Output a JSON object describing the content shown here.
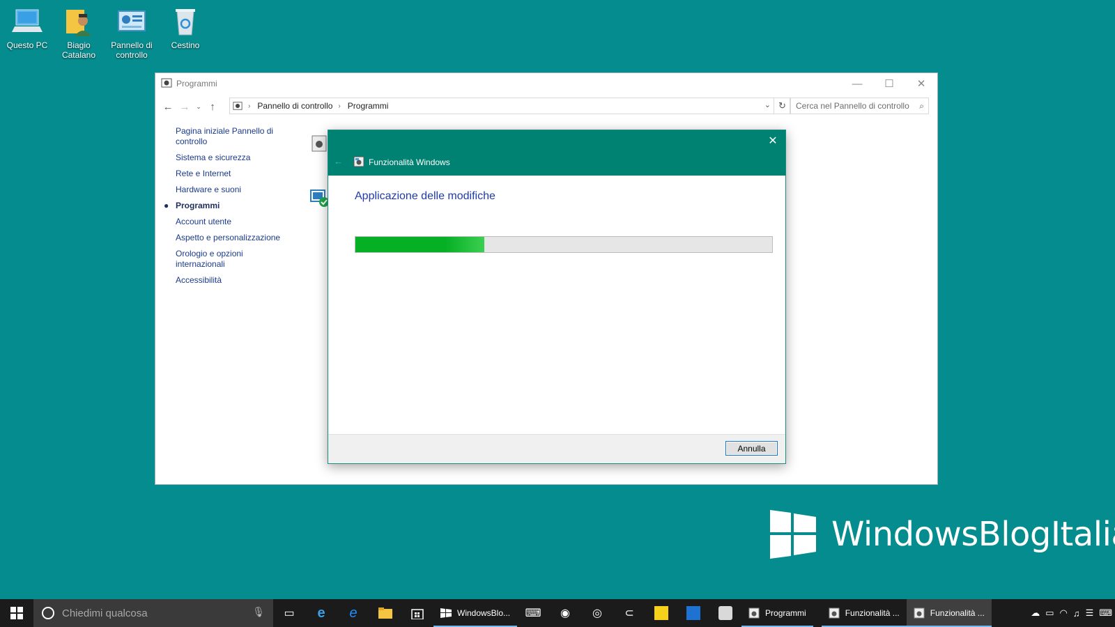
{
  "desktop": {
    "icons": [
      {
        "label_1": "Questo PC",
        "label_2": ""
      },
      {
        "label_1": "Biagio",
        "label_2": "Catalano"
      },
      {
        "label_1": "Pannello di",
        "label_2": "controllo"
      },
      {
        "label_1": "Cestino",
        "label_2": ""
      }
    ]
  },
  "window": {
    "title": "Programmi",
    "minimize_glyph": "—",
    "maximize_glyph": "☐",
    "close_glyph": "✕",
    "breadcrumb": [
      "Pannello di controllo",
      "Programmi"
    ],
    "search_placeholder": "Cerca nel Pannello di controllo"
  },
  "sidebar": {
    "items": [
      {
        "label": "Pagina iniziale Pannello di controllo",
        "active": false
      },
      {
        "label": "Sistema e sicurezza",
        "active": false
      },
      {
        "label": "Rete e Internet",
        "active": false
      },
      {
        "label": "Hardware e suoni",
        "active": false
      },
      {
        "label": "Programmi",
        "active": true
      },
      {
        "label": "Account utente",
        "active": false
      },
      {
        "label": "Aspetto e personalizzazione",
        "active": false
      },
      {
        "label": "Orologio e opzioni internazionali",
        "active": false
      },
      {
        "label": "Accessibilità",
        "active": false
      }
    ]
  },
  "dialog": {
    "title": "Funzionalità Windows",
    "heading": "Applicazione delle modifiche",
    "progress_fraction": 0.31,
    "cancel_label": "Annulla",
    "header_color": "#008272"
  },
  "watermark": {
    "text": "WindowsBlogItalia"
  },
  "taskbar": {
    "search_placeholder": "Chiedimi qualcosa",
    "apps": [
      {
        "label": "WindowsBlo...",
        "icon": "windowsblog-icon"
      },
      {
        "label": "Programmi",
        "icon": "control-panel-icon"
      },
      {
        "label": "Funzionalità ...",
        "icon": "windows-features-icon"
      },
      {
        "label": "Funzionalità ...",
        "icon": "windows-features-icon"
      }
    ]
  },
  "colors": {
    "desktop": "#058c8f",
    "accent": "#008272",
    "progress": "#06b025",
    "link": "#1a3a8a"
  }
}
